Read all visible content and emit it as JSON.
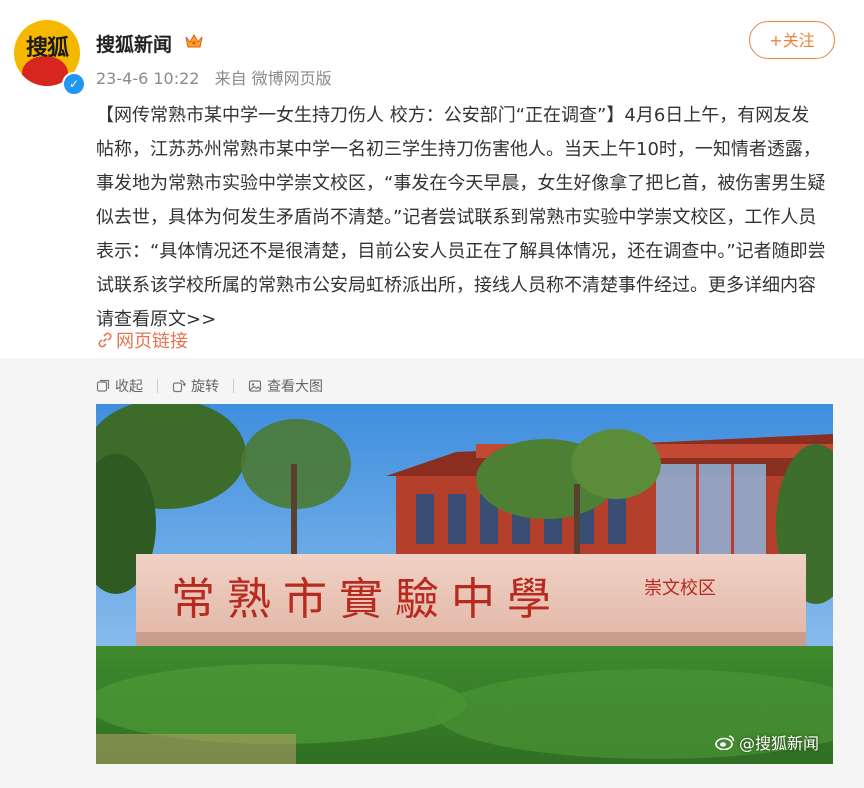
{
  "post": {
    "author": "搜狐新闻",
    "avatar_text": "搜狐",
    "timestamp": "23-4-6 10:22",
    "source": "来自 微博网页版",
    "follow_label": "+关注",
    "content": "【网传常熟市某中学一女生持刀伤人 校方：公安部门“正在调查”】4月6日上午，有网友发帖称，江苏苏州常熟市某中学一名初三学生持刀伤害他人。当天上午10时，一知情者透露，事发地为常熟市实验中学崇文校区，“事发在今天早晨，女生好像拿了把匕首，被伤害男生疑似去世，具体为何发生矛盾尚不清楚。”记者尝试联系到常熟市实验中学崇文校区，工作人员表示：“具体情况还不是很清楚，目前公安人员正在了解具体情况，还在调查中。”记者随即尝试联系该学校所属的常熟市公安局虹桥派出所，接线人员称不清楚事件经过。更多详细内容请查看原文>>",
    "web_link_label": "网页链接"
  },
  "toolbar": {
    "collapse_label": "收起",
    "rotate_label": "旋转",
    "view_large_label": "查看大图"
  },
  "photo": {
    "sign_text": "常熟市實驗中學",
    "sign_side_text": "崇文校区",
    "watermark": "@搜狐新闻"
  },
  "icons": {
    "avatar": "sohu-fox-logo",
    "verified": "verified-badge-icon",
    "crown": "crown-icon",
    "link": "link-icon",
    "collapse": "collapse-icon",
    "rotate": "rotate-icon",
    "view_large": "image-icon",
    "weibo": "weibo-logo-icon"
  },
  "colors": {
    "accent": "#eb7350",
    "follow": "#f0833a",
    "verified": "#2196f3"
  }
}
